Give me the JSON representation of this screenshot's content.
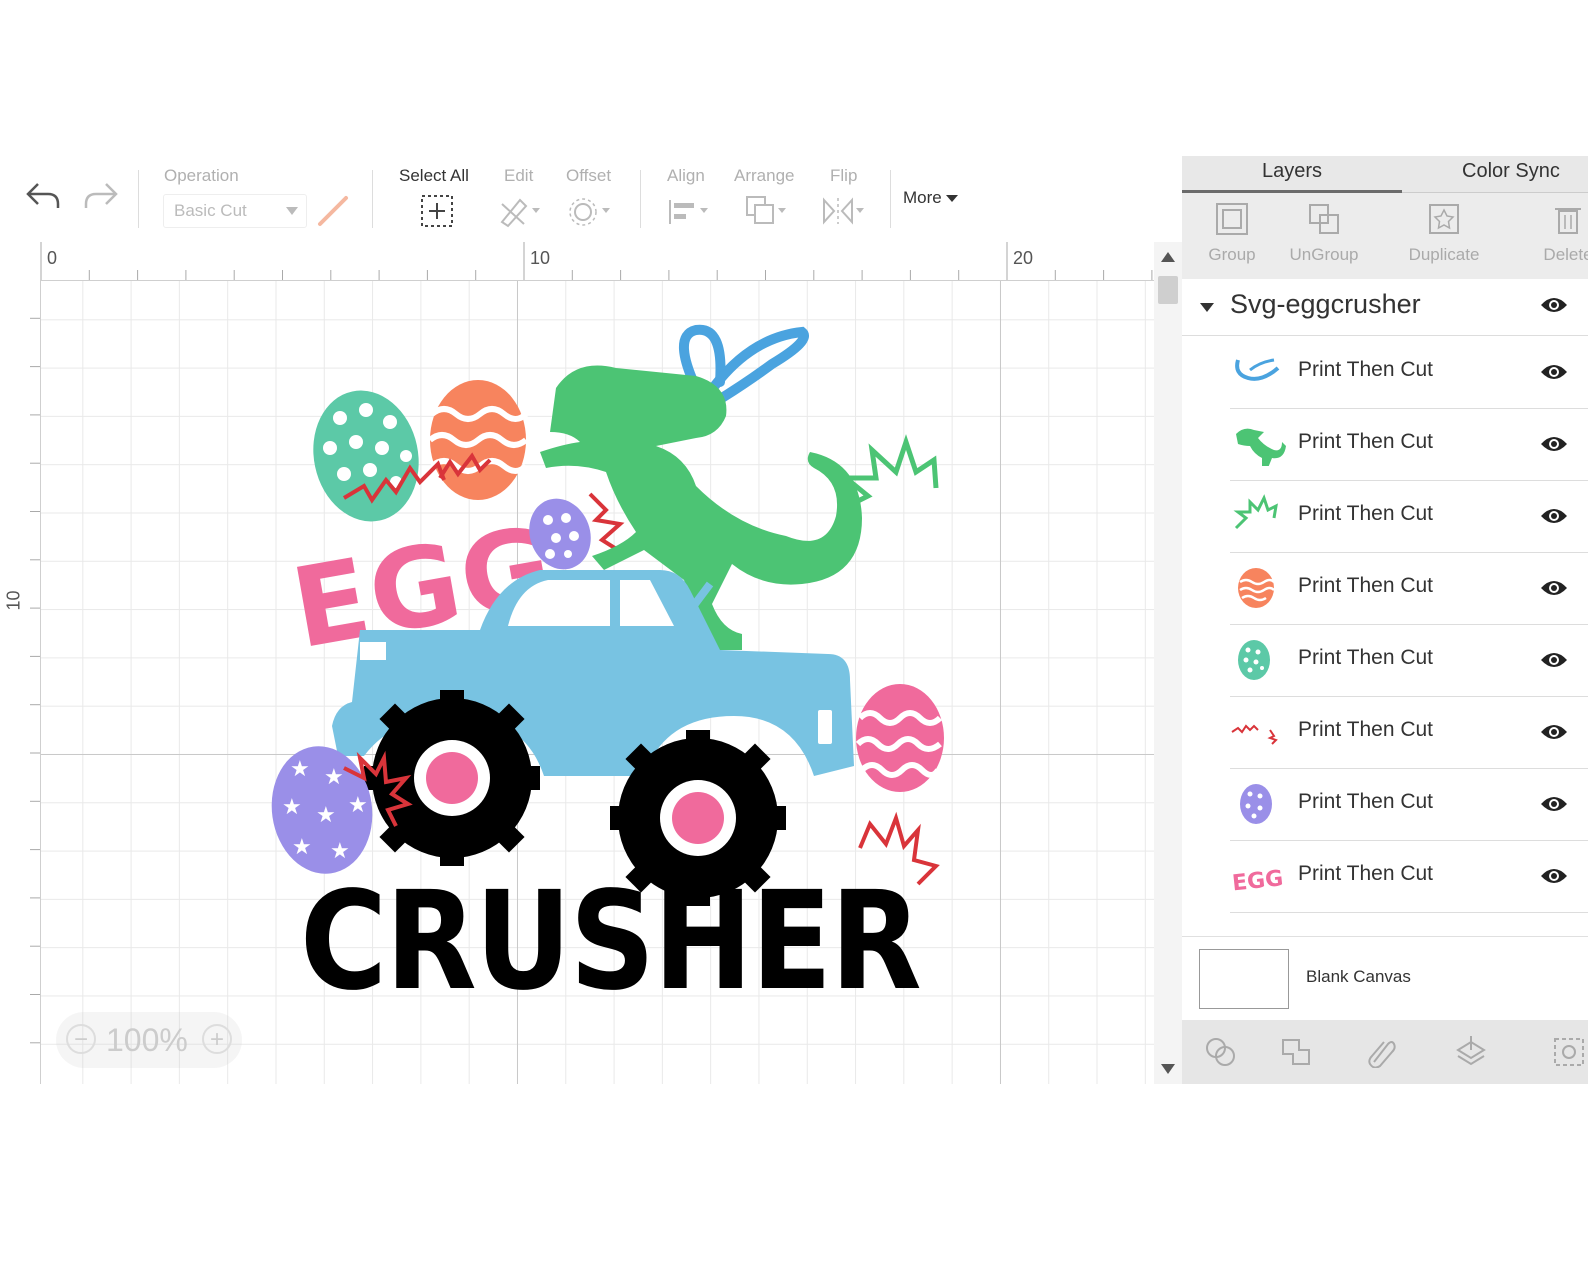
{
  "toolbar": {
    "operation_label": "Operation",
    "operation_value": "Basic Cut",
    "select_all": "Select All",
    "edit": "Edit",
    "offset": "Offset",
    "align": "Align",
    "arrange": "Arrange",
    "flip": "Flip",
    "more": "More"
  },
  "ruler": {
    "top": [
      "0",
      "10",
      "20"
    ],
    "left": [
      "10"
    ]
  },
  "canvas": {
    "zoom": "100%",
    "zoom_minus": "−",
    "zoom_plus": "+"
  },
  "panel": {
    "tabs": [
      "Layers",
      "Color Sync"
    ],
    "actions": [
      "Group",
      "UnGroup",
      "Duplicate",
      "Delete"
    ],
    "group_name": "Svg-eggcrusher",
    "layers": [
      {
        "name": "Print Then Cut",
        "thumb": "bunny-ears",
        "color": "#4aa3df"
      },
      {
        "name": "Print Then Cut",
        "thumb": "dinosaur",
        "color": "#4cc474"
      },
      {
        "name": "Print Then Cut",
        "thumb": "spark",
        "color": "#4cc474"
      },
      {
        "name": "Print Then Cut",
        "thumb": "orange-egg",
        "color": "#f7845e"
      },
      {
        "name": "Print Then Cut",
        "thumb": "teal-egg",
        "color": "#5cc9a7"
      },
      {
        "name": "Print Then Cut",
        "thumb": "red-cracks",
        "color": "#d9343a"
      },
      {
        "name": "Print Then Cut",
        "thumb": "purple-egg",
        "color": "#9a8fe8"
      },
      {
        "name": "Print Then Cut",
        "thumb": "egg-text",
        "color": "#f06a9c"
      }
    ],
    "blank_canvas": "Blank Canvas"
  },
  "artwork": {
    "word1": "EGG",
    "word2": "CRUSHER",
    "colors": {
      "pink": "#f06a9c",
      "green": "#4cc474",
      "truck": "#78c3e2",
      "ears": "#4aa3df",
      "teal": "#5cc9a7",
      "orange": "#f7845e",
      "purple": "#9a8fe8",
      "red": "#d9343a"
    }
  }
}
